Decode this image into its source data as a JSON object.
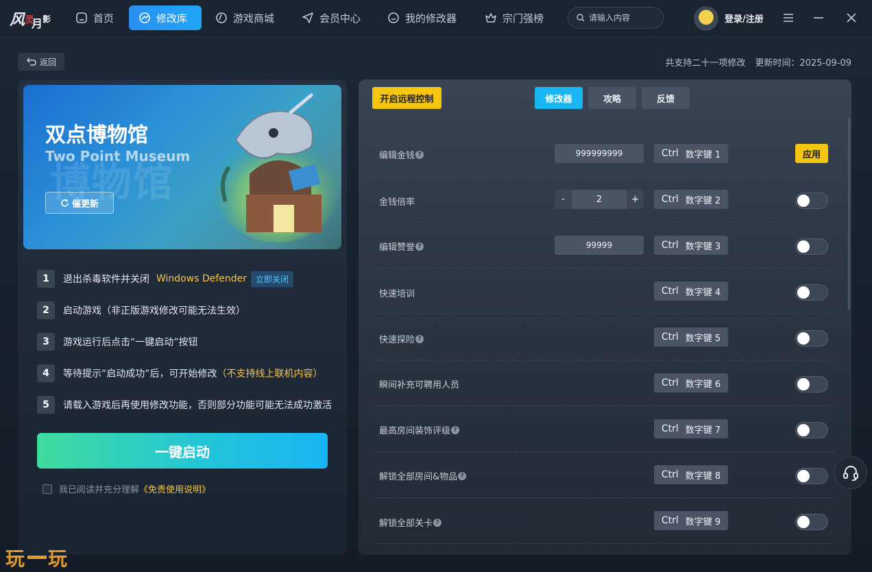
{
  "brand": {
    "logo_text": "风灵月影",
    "watermark": "玩一玩"
  },
  "nav": {
    "items": [
      {
        "label": "首页",
        "icon": "home-icon"
      },
      {
        "label": "修改库",
        "icon": "library-icon",
        "active": true
      },
      {
        "label": "游戏商城",
        "icon": "store-icon"
      },
      {
        "label": "会员中心",
        "icon": "send-icon"
      },
      {
        "label": "我的修改器",
        "icon": "chat-icon"
      },
      {
        "label": "宗门强榜",
        "icon": "crown-icon"
      }
    ],
    "search_placeholder": "请输入内容",
    "login_label": "登录/注册"
  },
  "subheader": {
    "back_label": "返回",
    "supported": "共支持二十一项修改",
    "updated": "更新时间：2025-09-09"
  },
  "game": {
    "title_cn": "双点博物馆",
    "title_en": "Two Point Museum",
    "bg_text": "博物馆",
    "urge_label": "催更新"
  },
  "steps": [
    {
      "num": "1",
      "text": "退出杀毒软件并关闭",
      "highlight": "Windows Defender",
      "action": "立即关闭"
    },
    {
      "num": "2",
      "text": "启动游戏（非正版游戏修改可能无法生效）"
    },
    {
      "num": "3",
      "text": "游戏运行后点击“一键启动”按钮"
    },
    {
      "num": "4",
      "text": "等待提示“启动成功”后，可开始修改",
      "highlight": "（不支持线上联机内容）"
    },
    {
      "num": "5",
      "text": "请载入游戏后再使用修改功能，否则部分功能可能无法成功激活"
    }
  ],
  "start_label": "一键启动",
  "agree": {
    "text": "我已阅读并充分理解",
    "link": "《免责使用说明》",
    "checked": false
  },
  "right": {
    "remote_label": "开启远程控制",
    "tabs": [
      {
        "label": "修改器",
        "active": true
      },
      {
        "label": "攻略"
      },
      {
        "label": "反馈"
      }
    ]
  },
  "cheats": [
    {
      "label": "编辑金钱",
      "help": true,
      "value": "999999999",
      "key1": "Ctrl",
      "key2": "数字键 1",
      "control": "apply",
      "apply_label": "应用"
    },
    {
      "label": "金钱倍率",
      "help": false,
      "stepper": "2",
      "key1": "Ctrl",
      "key2": "数字键 2",
      "control": "toggle"
    },
    {
      "label": "编辑赞誉",
      "help": true,
      "value": "99999",
      "key1": "Ctrl",
      "key2": "数字键 3",
      "control": "toggle"
    },
    {
      "label": "快速培训",
      "help": false,
      "key1": "Ctrl",
      "key2": "数字键 4",
      "control": "toggle"
    },
    {
      "label": "快速探险",
      "help": true,
      "key1": "Ctrl",
      "key2": "数字键 5",
      "control": "toggle"
    },
    {
      "label": "瞬间补充可聘用人员",
      "help": false,
      "key1": "Ctrl",
      "key2": "数字键 6",
      "control": "toggle"
    },
    {
      "label": "最高房间装饰评级",
      "help": true,
      "key1": "Ctrl",
      "key2": "数字键 7",
      "control": "toggle"
    },
    {
      "label": "解锁全部房间&物品",
      "help": true,
      "key1": "Ctrl",
      "key2": "数字键 8",
      "control": "toggle"
    },
    {
      "label": "解锁全部关卡",
      "help": true,
      "key1": "Ctrl",
      "key2": "数字键 9",
      "control": "toggle"
    }
  ],
  "colors": {
    "accent": "#21a6f7",
    "highlight": "#f6c744",
    "apply": "#f5c611",
    "start_from": "#3fdc9e",
    "start_to": "#17b4f5"
  }
}
